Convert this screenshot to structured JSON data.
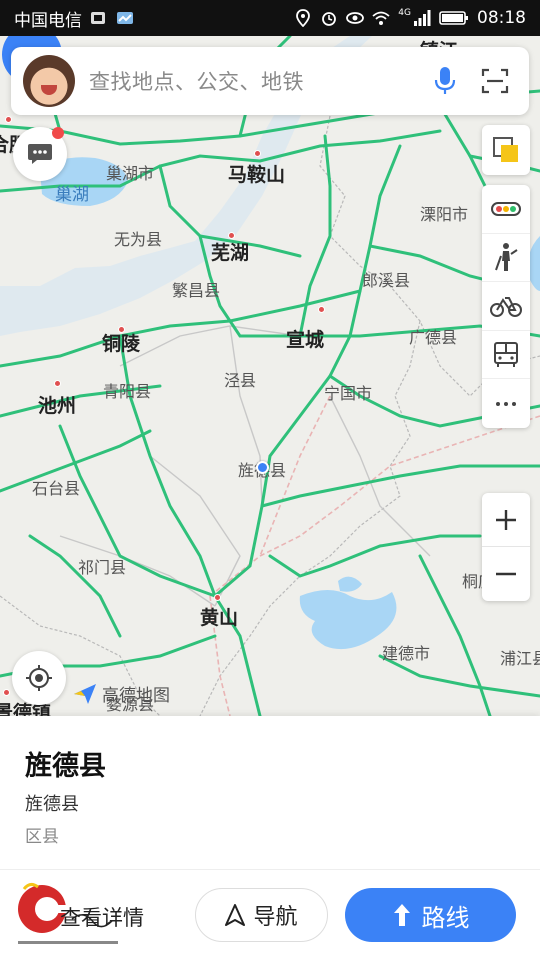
{
  "status": {
    "carrier": "中国电信",
    "network": "4G",
    "time": "08:18"
  },
  "search": {
    "placeholder": "查找地点、公交、地铁"
  },
  "map": {
    "labels": [
      {
        "text": "镇江",
        "kind": "big"
      },
      {
        "text": "合肥",
        "kind": "big"
      },
      {
        "text": "巢湖市",
        "kind": "mid"
      },
      {
        "text": "马鞍山",
        "kind": "big"
      },
      {
        "text": "溧阳市",
        "kind": "mid"
      },
      {
        "text": "巢湖",
        "kind": "blue"
      },
      {
        "text": "无为县",
        "kind": "mid"
      },
      {
        "text": "芜湖",
        "kind": "big"
      },
      {
        "text": "郎溪县",
        "kind": "mid"
      },
      {
        "text": "繁昌县",
        "kind": "mid"
      },
      {
        "text": "铜陵",
        "kind": "big"
      },
      {
        "text": "宣城",
        "kind": "big"
      },
      {
        "text": "广德县",
        "kind": "mid"
      },
      {
        "text": "泾县",
        "kind": "mid"
      },
      {
        "text": "青阳县",
        "kind": "mid"
      },
      {
        "text": "宁国市",
        "kind": "mid"
      },
      {
        "text": "池州",
        "kind": "big"
      },
      {
        "text": "旌德县",
        "kind": "mid"
      },
      {
        "text": "石台县",
        "kind": "mid"
      },
      {
        "text": "祁门县",
        "kind": "mid"
      },
      {
        "text": "桐庐",
        "kind": "mid"
      },
      {
        "text": "黄山",
        "kind": "big"
      },
      {
        "text": "建德市",
        "kind": "mid"
      },
      {
        "text": "浦江县",
        "kind": "mid"
      },
      {
        "text": "婺源县",
        "kind": "mid"
      },
      {
        "text": "景德镇",
        "kind": "big"
      }
    ],
    "attribution": "高德地图"
  },
  "place": {
    "title": "旌德县",
    "subtitle": "旌德县",
    "type": "区县"
  },
  "actions": {
    "details": "查看详情",
    "navigate": "导航",
    "route": "路线"
  },
  "colors": {
    "accent": "#3b82f6",
    "road": "#2fc07a",
    "water": "#a9d6f5"
  }
}
